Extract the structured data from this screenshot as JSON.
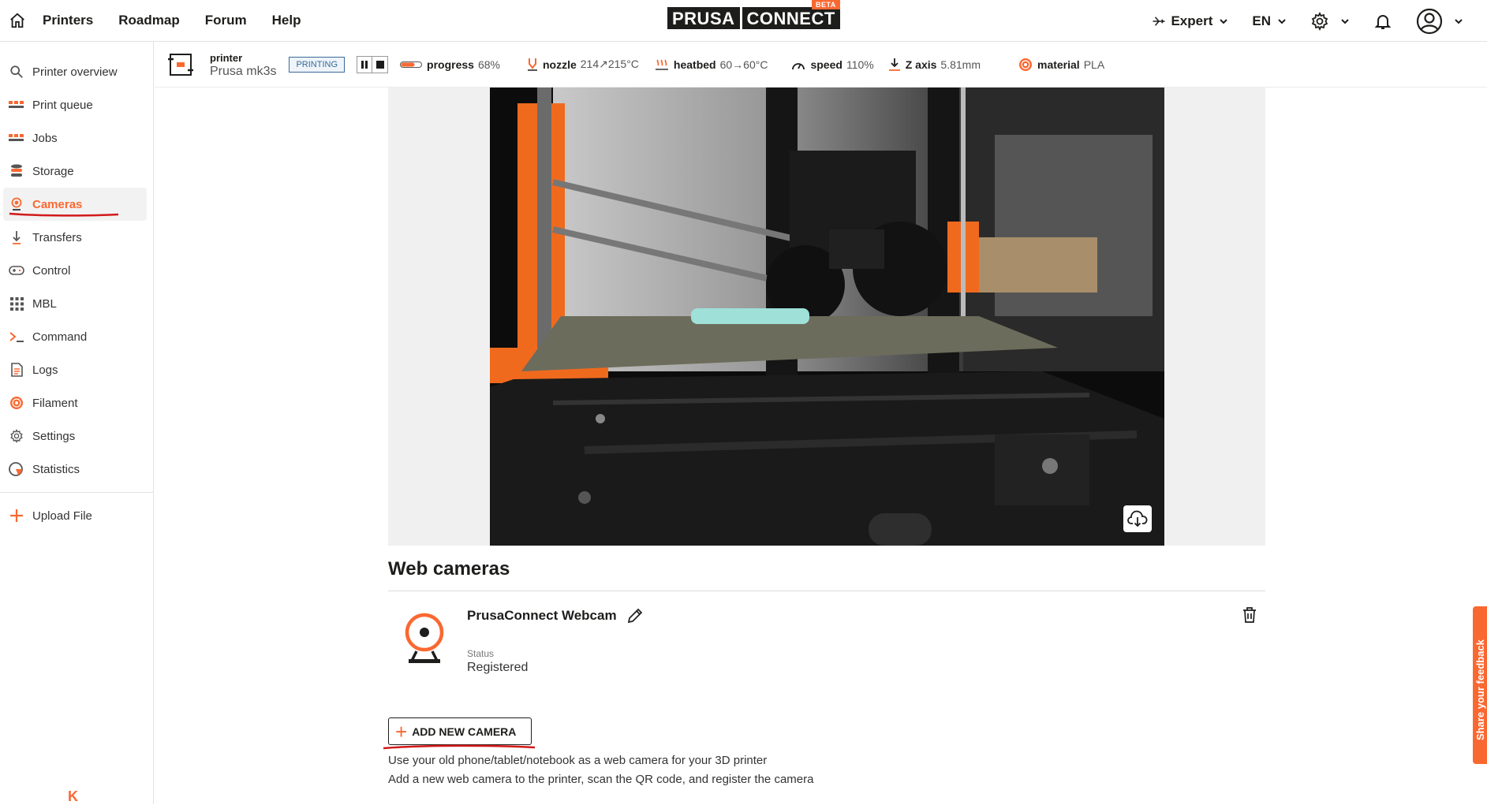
{
  "topbar": {
    "nav": [
      "Printers",
      "Roadmap",
      "Forum",
      "Help"
    ],
    "logo": {
      "left": "PRUSA",
      "right": "CONNECT",
      "badge": "BETA"
    },
    "mode_label": "Expert",
    "language": "EN"
  },
  "sidebar": {
    "items": [
      {
        "label": "Printer overview",
        "icon": "search-icon"
      },
      {
        "label": "Print queue",
        "icon": "queue-icon"
      },
      {
        "label": "Jobs",
        "icon": "jobs-icon"
      },
      {
        "label": "Storage",
        "icon": "storage-icon"
      },
      {
        "label": "Cameras",
        "icon": "camera-icon"
      },
      {
        "label": "Transfers",
        "icon": "transfer-icon"
      },
      {
        "label": "Control",
        "icon": "gamepad-icon"
      },
      {
        "label": "MBL",
        "icon": "grid-icon"
      },
      {
        "label": "Command",
        "icon": "terminal-icon"
      },
      {
        "label": "Logs",
        "icon": "log-icon"
      },
      {
        "label": "Filament",
        "icon": "filament-icon"
      },
      {
        "label": "Settings",
        "icon": "gear-icon"
      },
      {
        "label": "Statistics",
        "icon": "chart-icon"
      }
    ],
    "upload_label": "Upload File",
    "active": "Cameras",
    "collapse_glyph": "K"
  },
  "printer_bar": {
    "label": "printer",
    "name": "Prusa mk3s",
    "state": "PRINTING",
    "progress": {
      "label": "progress",
      "value": "68%"
    },
    "nozzle": {
      "label": "nozzle",
      "value": "214↗215°C"
    },
    "heatbed": {
      "label": "heatbed",
      "value": "60→60°C"
    },
    "speed": {
      "label": "speed",
      "value": "110%"
    },
    "zaxis": {
      "label": "Z axis",
      "value": "5.81mm"
    },
    "material": {
      "label": "material",
      "value": "PLA"
    }
  },
  "main": {
    "section_title": "Web cameras",
    "camera": {
      "name": "PrusaConnect Webcam",
      "status_label": "Status",
      "status_value": "Registered"
    },
    "add_button": "ADD NEW CAMERA",
    "hint_line1": "Use your old phone/tablet/notebook as a web camera for your 3D printer",
    "hint_line2": "Add a new web camera to the printer, scan the QR code, and register the camera"
  },
  "feedback_tab": "Share your feedback",
  "colors": {
    "accent": "#fa6831",
    "annotation": "#d21a1a"
  }
}
